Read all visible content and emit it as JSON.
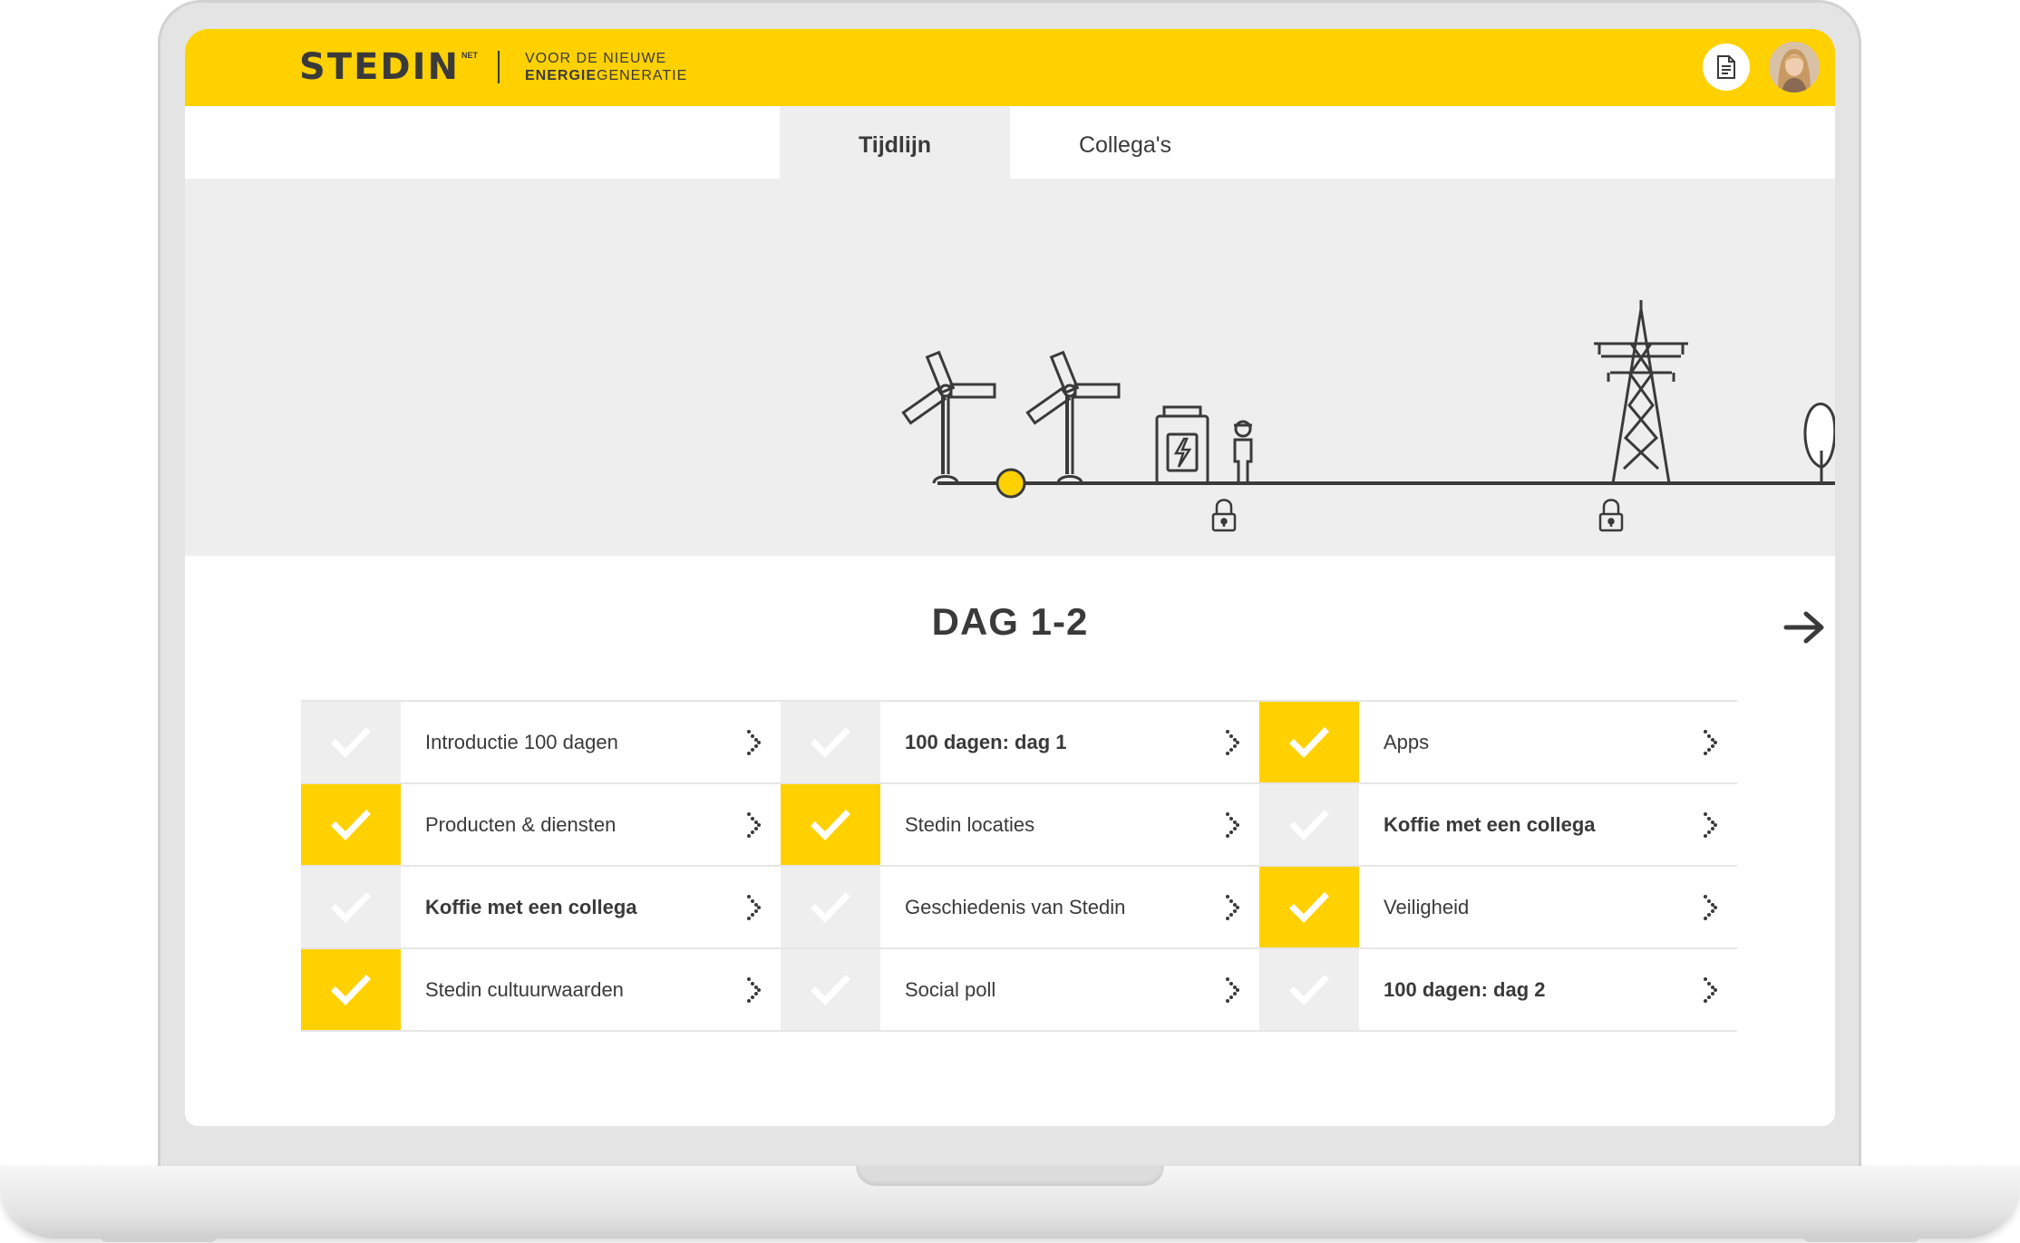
{
  "brand": {
    "logo_text": "STEDIN",
    "logo_sup": "NET",
    "tagline_line1": "VOOR DE NIEUWE",
    "tagline_bold": "ENERGIE",
    "tagline_rest": "GENERATIE",
    "accent_color": "#ffd100"
  },
  "header": {
    "doc_icon": "document-icon",
    "avatar": "user-avatar"
  },
  "tabs": [
    {
      "label": "Tijdlijn",
      "active": true
    },
    {
      "label": "Collega's",
      "active": false
    }
  ],
  "timeline": {
    "icons": [
      "wind-turbine-icon",
      "wind-turbine-icon",
      "progress-marker",
      "battery-icon",
      "worker-icon",
      "lock-icon",
      "power-pylon-icon",
      "lock-icon",
      "tree-icon"
    ]
  },
  "day": {
    "title": "DAG 1-2",
    "next_icon": "arrow-right-icon"
  },
  "tasks": [
    {
      "label": "Introductie 100 dagen",
      "done": false,
      "bold": false
    },
    {
      "label": "100 dagen: dag 1",
      "done": false,
      "bold": true
    },
    {
      "label": "Apps",
      "done": true,
      "bold": false
    },
    {
      "label": "Producten & diensten",
      "done": true,
      "bold": false
    },
    {
      "label": "Stedin locaties",
      "done": true,
      "bold": false
    },
    {
      "label": "Koffie met een collega",
      "done": false,
      "bold": true
    },
    {
      "label": "Koffie met een collega",
      "done": false,
      "bold": true
    },
    {
      "label": "Geschiedenis van Stedin",
      "done": false,
      "bold": false
    },
    {
      "label": "Veiligheid",
      "done": true,
      "bold": false
    },
    {
      "label": "Stedin cultuurwaarden",
      "done": true,
      "bold": false
    },
    {
      "label": "Social poll",
      "done": false,
      "bold": false
    },
    {
      "label": "100 dagen: dag 2",
      "done": false,
      "bold": true
    }
  ]
}
